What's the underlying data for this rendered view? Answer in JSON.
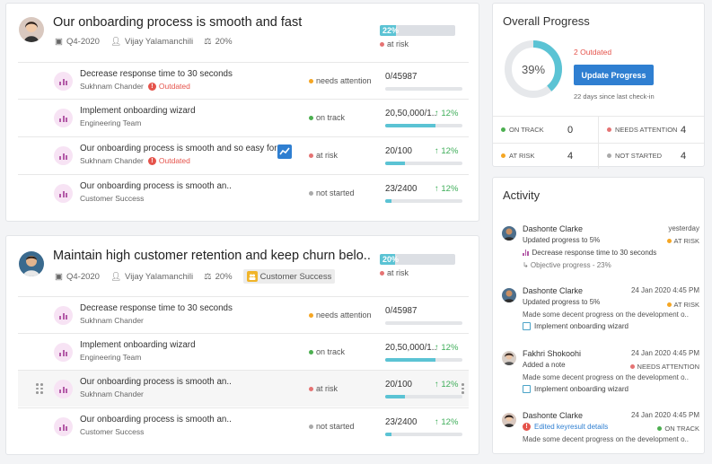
{
  "objectives": [
    {
      "title": "Our onboarding process is smooth and fast",
      "quarter": "Q4-2020",
      "owner": "Vijay Yalamanchili",
      "weight": "20%",
      "progress": "22%",
      "progress_value": 0.22,
      "status": "at risk",
      "status_color": "#e57373",
      "key_results": [
        {
          "title": "Decrease response time to 30 seconds",
          "subtitle": "Sukhnam Chander",
          "outdated": "Outdated",
          "status": "needs attention",
          "status_color": "#f5a623",
          "value": "0/45987",
          "delta": "",
          "progress_value": 0.0
        },
        {
          "title": "Implement onboarding wizard",
          "subtitle": "Engineering Team",
          "outdated": "",
          "status": "on track",
          "status_color": "#4caf50",
          "value": "20,50,000/1..",
          "delta": "↑ 12%",
          "progress_value": 0.65
        },
        {
          "title": "Our onboarding process is smooth and so easy for",
          "subtitle": "Sukhnam Chander",
          "outdated": "Outdated",
          "status": "at risk",
          "status_color": "#e57373",
          "value": "20/100",
          "delta": "↑ 12%",
          "progress_value": 0.25
        },
        {
          "title": "Our onboarding process is smooth an..",
          "subtitle": "Customer Success",
          "outdated": "",
          "status": "not started",
          "status_color": "#aaaaaa",
          "value": "23/2400",
          "delta": "↑ 12%",
          "progress_value": 0.08
        }
      ]
    },
    {
      "title": "Maintain high customer retention and keep churn belo..",
      "quarter": "Q4-2020",
      "owner": "Vijay Yalamanchili",
      "weight": "20%",
      "tag": "Customer Success",
      "progress": "20%",
      "progress_value": 0.2,
      "status": "at risk",
      "status_color": "#e57373",
      "key_results": [
        {
          "title": "Decrease response time to 30 seconds",
          "subtitle": "Sukhnam Chander",
          "outdated": "",
          "status": "needs attention",
          "status_color": "#f5a623",
          "value": "0/45987",
          "delta": "",
          "progress_value": 0.0
        },
        {
          "title": "Implement onboarding wizard",
          "subtitle": "Engineering Team",
          "outdated": "",
          "status": "on track",
          "status_color": "#4caf50",
          "value": "20,50,000/1..",
          "delta": "↑ 12%",
          "progress_value": 0.65
        },
        {
          "title": "Our onboarding process is smooth an..",
          "subtitle": "Sukhnam Chander",
          "outdated": "",
          "status": "at risk",
          "status_color": "#e57373",
          "value": "20/100",
          "delta": "↑ 12%",
          "progress_value": 0.25
        },
        {
          "title": "Our onboarding process is smooth an..",
          "subtitle": "Customer Success",
          "outdated": "",
          "status": "not started",
          "status_color": "#aaaaaa",
          "value": "23/2400",
          "delta": "↑ 12%",
          "progress_value": 0.08
        }
      ]
    }
  ],
  "overall": {
    "title": "Overall Progress",
    "percent": "39%",
    "percent_value": 0.39,
    "outdated": "2 Outdated",
    "button": "Update Progress",
    "since": "22 days since last check-in",
    "stats": [
      {
        "label": "ON TRACK",
        "value": "0",
        "color": "#4caf50"
      },
      {
        "label": "NEEDS ATTENTION",
        "value": "4",
        "color": "#e57373"
      },
      {
        "label": "AT RISK",
        "value": "4",
        "color": "#f5a623"
      },
      {
        "label": "NOT STARTED",
        "value": "4",
        "color": "#aaaaaa"
      }
    ]
  },
  "activity": {
    "title": "Activity",
    "items": [
      {
        "name": "Dashonte Clarke",
        "time": "yesterday",
        "line": "Updated progress to 5%",
        "badge": "AT RISK",
        "badge_color": "#f5a623",
        "sub": "Decrease response time to 30 seconds",
        "sub_icon": "kr-icon",
        "note": "↳ Objective progress - 23%"
      },
      {
        "name": "Dashonte Clarke",
        "time": "24 Jan 2020 4:45 PM",
        "line": "Updated progress to 5%",
        "badge": "AT RISK",
        "badge_color": "#f5a623",
        "note": "Made some decent progress on the development o..",
        "sub": "Implement onboarding wizard",
        "sub_icon": "objective-icon"
      },
      {
        "name": "Fakhri Shokoohi",
        "time": "24 Jan 2020 4:45 PM",
        "line": "Added a note",
        "badge": "NEEDS ATTENTION",
        "badge_color": "#e57373",
        "note": "Made some decent progress on the development o..",
        "sub": "Implement onboarding wizard",
        "sub_icon": "objective-icon"
      },
      {
        "name": "Dashonte Clarke",
        "time": "24 Jan 2020 4:45 PM",
        "line": "Edited keyresult details",
        "badge": "ON TRACK",
        "badge_color": "#4caf50",
        "note": "Made some decent progress on the development o..",
        "line_icon": "alert-icon"
      }
    ]
  }
}
